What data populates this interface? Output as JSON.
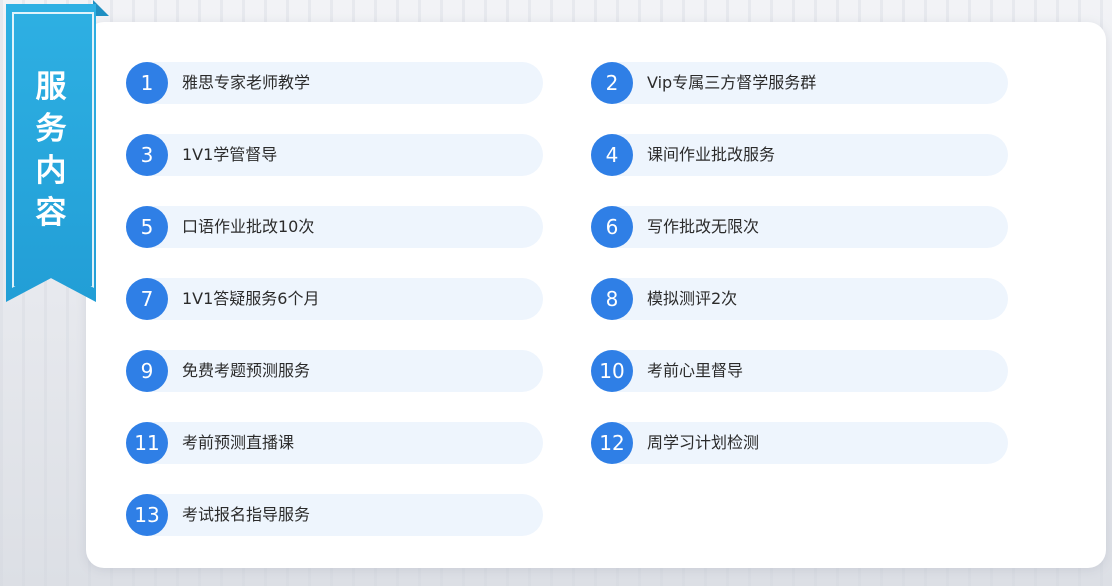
{
  "ribbon": {
    "title_chars": [
      "服",
      "务",
      "内",
      "容"
    ]
  },
  "services": [
    {
      "num": "1",
      "label": "雅思专家老师教学"
    },
    {
      "num": "2",
      "label": "Vip专属三方督学服务群"
    },
    {
      "num": "3",
      "label": "1V1学管督导"
    },
    {
      "num": "4",
      "label": "课间作业批改服务"
    },
    {
      "num": "5",
      "label": "口语作业批改10次"
    },
    {
      "num": "6",
      "label": "写作批改无限次"
    },
    {
      "num": "7",
      "label": "1V1答疑服务6个月"
    },
    {
      "num": "8",
      "label": "模拟测评2次"
    },
    {
      "num": "9",
      "label": "免费考题预测服务"
    },
    {
      "num": "10",
      "label": "考前心里督导"
    },
    {
      "num": "11",
      "label": "考前预测直播课"
    },
    {
      "num": "12",
      "label": "周学习计划检测"
    },
    {
      "num": "13",
      "label": "考试报名指导服务"
    }
  ],
  "colors": {
    "accent": "#2f7fe6",
    "ribbon": "#26a6dd",
    "pill": "#eef5fd"
  }
}
